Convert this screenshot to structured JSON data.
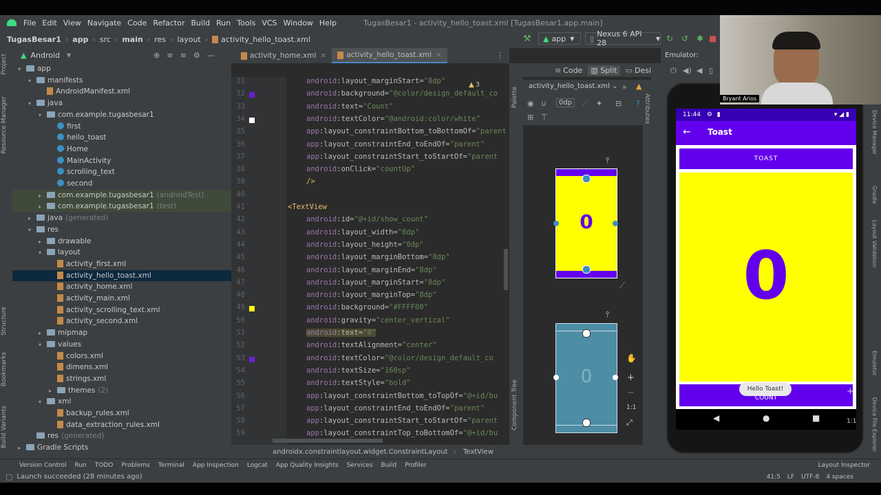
{
  "menu": {
    "items": [
      "File",
      "Edit",
      "View",
      "Navigate",
      "Code",
      "Refactor",
      "Build",
      "Run",
      "Tools",
      "VCS",
      "Window",
      "Help"
    ],
    "window_title": "TugasBesar1 - activity_hello_toast.xml [TugasBesar1.app.main]"
  },
  "breadcrumb": [
    "TugasBesar1",
    "app",
    "src",
    "main",
    "res",
    "layout",
    "activity_hello_toast.xml"
  ],
  "run_config": "app",
  "device_config": "Nexus 6 API 28",
  "project_panel": {
    "view_mode": "Android",
    "tree": [
      {
        "label": "app",
        "indent": 0,
        "type": "folder",
        "arrow": "▾"
      },
      {
        "label": "manifests",
        "indent": 1,
        "type": "folder",
        "arrow": "▾"
      },
      {
        "label": "AndroidManifest.xml",
        "indent": 2,
        "type": "xml",
        "arrow": ""
      },
      {
        "label": "java",
        "indent": 1,
        "type": "folder",
        "arrow": "▾"
      },
      {
        "label": "com.example.tugasbesar1",
        "indent": 2,
        "type": "folder",
        "arrow": "▾"
      },
      {
        "label": "first",
        "indent": 3,
        "type": "class",
        "arrow": ""
      },
      {
        "label": "hello_toast",
        "indent": 3,
        "type": "class",
        "arrow": ""
      },
      {
        "label": "Home",
        "indent": 3,
        "type": "class",
        "arrow": ""
      },
      {
        "label": "MainActivity",
        "indent": 3,
        "type": "class",
        "arrow": ""
      },
      {
        "label": "scrolling_text",
        "indent": 3,
        "type": "class",
        "arrow": ""
      },
      {
        "label": "second",
        "indent": 3,
        "type": "class",
        "arrow": ""
      },
      {
        "label": "com.example.tugasbesar1",
        "suffix": "(androidTest)",
        "indent": 2,
        "type": "folder",
        "arrow": "▸",
        "highlight": true
      },
      {
        "label": "com.example.tugasbesar1",
        "suffix": "(test)",
        "indent": 2,
        "type": "folder",
        "arrow": "▸",
        "highlight": true
      },
      {
        "label": "java",
        "suffix": "(generated)",
        "indent": 1,
        "type": "folder",
        "arrow": "▸"
      },
      {
        "label": "res",
        "indent": 1,
        "type": "folder",
        "arrow": "▾"
      },
      {
        "label": "drawable",
        "indent": 2,
        "type": "folder",
        "arrow": "▸"
      },
      {
        "label": "layout",
        "indent": 2,
        "type": "folder",
        "arrow": "▾"
      },
      {
        "label": "activity_first.xml",
        "indent": 3,
        "type": "xml",
        "arrow": ""
      },
      {
        "label": "activity_hello_toast.xml",
        "indent": 3,
        "type": "xml",
        "arrow": "",
        "selected": true
      },
      {
        "label": "activity_home.xml",
        "indent": 3,
        "type": "xml",
        "arrow": ""
      },
      {
        "label": "activity_main.xml",
        "indent": 3,
        "type": "xml",
        "arrow": ""
      },
      {
        "label": "activity_scrolling_text.xml",
        "indent": 3,
        "type": "xml",
        "arrow": ""
      },
      {
        "label": "activity_second.xml",
        "indent": 3,
        "type": "xml",
        "arrow": ""
      },
      {
        "label": "mipmap",
        "indent": 2,
        "type": "folder",
        "arrow": "▸"
      },
      {
        "label": "values",
        "indent": 2,
        "type": "folder",
        "arrow": "▾"
      },
      {
        "label": "colors.xml",
        "indent": 3,
        "type": "xml",
        "arrow": ""
      },
      {
        "label": "dimens.xml",
        "indent": 3,
        "type": "xml",
        "arrow": ""
      },
      {
        "label": "strings.xml",
        "indent": 3,
        "type": "xml",
        "arrow": ""
      },
      {
        "label": "themes",
        "suffix": "(2)",
        "indent": 3,
        "type": "folder",
        "arrow": "▸"
      },
      {
        "label": "xml",
        "indent": 2,
        "type": "folder",
        "arrow": "▾"
      },
      {
        "label": "backup_rules.xml",
        "indent": 3,
        "type": "xml",
        "arrow": ""
      },
      {
        "label": "data_extraction_rules.xml",
        "indent": 3,
        "type": "xml",
        "arrow": ""
      },
      {
        "label": "res",
        "suffix": "(generated)",
        "indent": 1,
        "type": "folder",
        "arrow": ""
      },
      {
        "label": "Gradle Scripts",
        "indent": 0,
        "type": "folder",
        "arrow": "▸"
      }
    ]
  },
  "editor": {
    "tabs": [
      {
        "label": "activity_home.xml",
        "active": false
      },
      {
        "label": "activity_hello_toast.xml",
        "active": true
      }
    ],
    "view_modes": [
      "Code",
      "Split",
      "Design"
    ],
    "warning_count": "3",
    "lines": [
      {
        "n": "31",
        "parts": [
          [
            "ns",
            "android"
          ],
          [
            "attr",
            ":layout_marginStart="
          ],
          [
            "val",
            "\"8dp\""
          ]
        ]
      },
      {
        "n": "32",
        "parts": [
          [
            "ns",
            "android"
          ],
          [
            "attr",
            ":background="
          ],
          [
            "val",
            "\"@color/design_default_co"
          ]
        ],
        "marker": "#6a1fd6"
      },
      {
        "n": "33",
        "parts": [
          [
            "ns",
            "android"
          ],
          [
            "attr",
            ":text="
          ],
          [
            "val",
            "\"Count\""
          ]
        ]
      },
      {
        "n": "34",
        "parts": [
          [
            "ns",
            "android"
          ],
          [
            "attr",
            ":textColor="
          ],
          [
            "val",
            "\"@android:color/white\""
          ]
        ],
        "marker": "#ffffff"
      },
      {
        "n": "35",
        "parts": [
          [
            "ns",
            "app"
          ],
          [
            "attr",
            ":layout_constraintBottom_toBottomOf="
          ],
          [
            "val",
            "\"parent"
          ]
        ]
      },
      {
        "n": "36",
        "parts": [
          [
            "ns",
            "app"
          ],
          [
            "attr",
            ":layout_constraintEnd_toEndOf="
          ],
          [
            "val",
            "\"parent\""
          ]
        ]
      },
      {
        "n": "37",
        "parts": [
          [
            "ns",
            "app"
          ],
          [
            "attr",
            ":layout_constraintStart_toStartOf="
          ],
          [
            "val",
            "\"parent"
          ]
        ]
      },
      {
        "n": "38",
        "parts": [
          [
            "ns",
            "android"
          ],
          [
            "attr",
            ":onClick="
          ],
          [
            "val",
            "\"countUp\""
          ]
        ]
      },
      {
        "n": "39",
        "parts": [
          [
            "tag",
            "/>"
          ]
        ]
      },
      {
        "n": "40",
        "parts": []
      },
      {
        "n": "41",
        "parts": [
          [
            "tag",
            "<TextView"
          ]
        ],
        "outdent": true
      },
      {
        "n": "42",
        "parts": [
          [
            "ns",
            "android"
          ],
          [
            "attr",
            ":id="
          ],
          [
            "val",
            "\"@+id/show_count\""
          ]
        ]
      },
      {
        "n": "43",
        "parts": [
          [
            "ns",
            "android"
          ],
          [
            "attr",
            ":layout_width="
          ],
          [
            "val",
            "\"0dp\""
          ]
        ]
      },
      {
        "n": "44",
        "parts": [
          [
            "ns",
            "android"
          ],
          [
            "attr",
            ":layout_height="
          ],
          [
            "val",
            "\"0dp\""
          ]
        ]
      },
      {
        "n": "45",
        "parts": [
          [
            "ns",
            "android"
          ],
          [
            "attr",
            ":layout_marginBottom="
          ],
          [
            "val",
            "\"8dp\""
          ]
        ]
      },
      {
        "n": "46",
        "parts": [
          [
            "ns",
            "android"
          ],
          [
            "attr",
            ":layout_marginEnd="
          ],
          [
            "val",
            "\"8dp\""
          ]
        ]
      },
      {
        "n": "47",
        "parts": [
          [
            "ns",
            "android"
          ],
          [
            "attr",
            ":layout_marginStart="
          ],
          [
            "val",
            "\"8dp\""
          ]
        ]
      },
      {
        "n": "48",
        "parts": [
          [
            "ns",
            "android"
          ],
          [
            "attr",
            ":layout_marginTop="
          ],
          [
            "val",
            "\"8dp\""
          ]
        ]
      },
      {
        "n": "49",
        "parts": [
          [
            "ns",
            "android"
          ],
          [
            "attr",
            ":background="
          ],
          [
            "val",
            "\"#FFFF00\""
          ]
        ],
        "marker": "#ffff00"
      },
      {
        "n": "50",
        "parts": [
          [
            "ns",
            "android"
          ],
          [
            "attr",
            ":gravity="
          ],
          [
            "val",
            "\"center_vertical\""
          ]
        ]
      },
      {
        "n": "51",
        "parts": [
          [
            "ns",
            "android"
          ],
          [
            "attr",
            ":text="
          ],
          [
            "val",
            "\"0\""
          ]
        ],
        "sel": true
      },
      {
        "n": "52",
        "parts": [
          [
            "ns",
            "android"
          ],
          [
            "attr",
            ":textAlignment="
          ],
          [
            "val",
            "\"center\""
          ]
        ]
      },
      {
        "n": "53",
        "parts": [
          [
            "ns",
            "android"
          ],
          [
            "attr",
            ":textColor="
          ],
          [
            "val",
            "\"@color/design_default_co"
          ]
        ],
        "marker": "#6a1fd6"
      },
      {
        "n": "54",
        "parts": [
          [
            "ns",
            "android"
          ],
          [
            "attr",
            ":textSize="
          ],
          [
            "val",
            "\"160sp\""
          ]
        ]
      },
      {
        "n": "55",
        "parts": [
          [
            "ns",
            "android"
          ],
          [
            "attr",
            ":textStyle="
          ],
          [
            "val",
            "\"bold\""
          ]
        ]
      },
      {
        "n": "56",
        "parts": [
          [
            "ns",
            "app"
          ],
          [
            "attr",
            ":layout_constraintBottom_toTopOf="
          ],
          [
            "val",
            "\"@+id/bu"
          ]
        ]
      },
      {
        "n": "57",
        "parts": [
          [
            "ns",
            "app"
          ],
          [
            "attr",
            ":layout_constraintEnd_toEndOf="
          ],
          [
            "val",
            "\"parent\""
          ]
        ]
      },
      {
        "n": "58",
        "parts": [
          [
            "ns",
            "app"
          ],
          [
            "attr",
            ":layout_constraintStart_toStartOf="
          ],
          [
            "val",
            "\"parent"
          ]
        ]
      },
      {
        "n": "59",
        "parts": [
          [
            "ns",
            "app"
          ],
          [
            "attr",
            ":layout_constraintTop_toBottomOf="
          ],
          [
            "val",
            "\"@+id/bu"
          ]
        ]
      }
    ],
    "crumbs": [
      "androidx.constraintlayout.widget.ConstraintLayout",
      "TextView"
    ]
  },
  "design": {
    "file_dropdown": "activity_hello_toast.xml",
    "margin_value": "0dp",
    "preview_count": "0",
    "palette_label": "Palette",
    "attributes_label": "Attributes",
    "component_tree_label": "Component Tree",
    "zoom_label": "1:1"
  },
  "emulator": {
    "header_label": "Emulator:",
    "status_time": "11:44",
    "app_title": "Toast",
    "toast_button": "TOAST",
    "count_value": "0",
    "toast_message": "Hello Toast!",
    "count_button": "COUNT",
    "zoom_label": "1:1"
  },
  "webcam_name": "Bryant Arios",
  "right_strip": [
    "Device Manager",
    "Gradle",
    "Layout Validation",
    "Emulator",
    "Device File Explorer"
  ],
  "left_strip": [
    "Project",
    "Resource Manager",
    "Structure",
    "Bookmarks",
    "Build Variants"
  ],
  "bottom_tools": [
    "Version Control",
    "Run",
    "TODO",
    "Problems",
    "Terminal",
    "App Inspection",
    "Logcat",
    "App Quality Insights",
    "Services",
    "Build",
    "Profiler"
  ],
  "layout_inspector": "Layout Inspector",
  "status": {
    "message": "Launch succeeded (28 minutes ago)",
    "position": "41:5",
    "line_sep": "LF",
    "encoding": "UTF-8",
    "indent": "4 spaces"
  },
  "colors": {
    "purple": "#6200ee",
    "yellow": "#ffff00",
    "blueprint": "#4d8da5",
    "darcula_bg": "#2b2b2b",
    "panel_bg": "#3c3f41"
  }
}
